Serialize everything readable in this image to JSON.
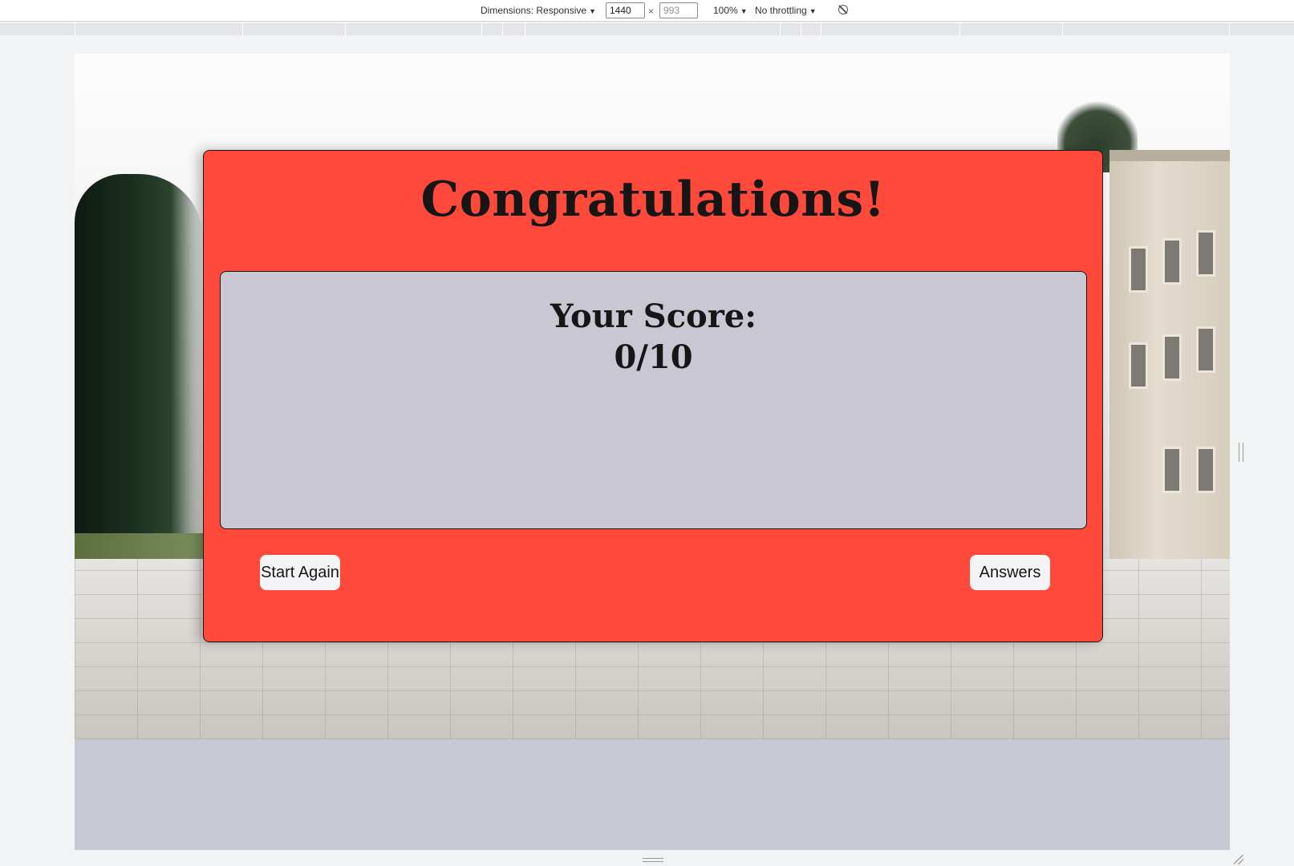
{
  "devtools": {
    "dimensions_label": "Dimensions: Responsive",
    "width_value": "1440",
    "height_value": "993",
    "times": "×",
    "zoom_label": "100%",
    "throttling_label": "No throttling",
    "dropdown_arrow": "▼",
    "rotate_icon": "rotate-icon"
  },
  "quiz": {
    "title": "Congratulations!",
    "score_label": "Your Score:",
    "score_value": "0/10",
    "start_again_label": "Start Again",
    "answers_label": "Answers"
  },
  "colors": {
    "card_background": "#ff4a3b",
    "score_box_background": "#c8c7d2",
    "page_background": "#c8c8d2",
    "button_background": "#f4f4f6"
  }
}
